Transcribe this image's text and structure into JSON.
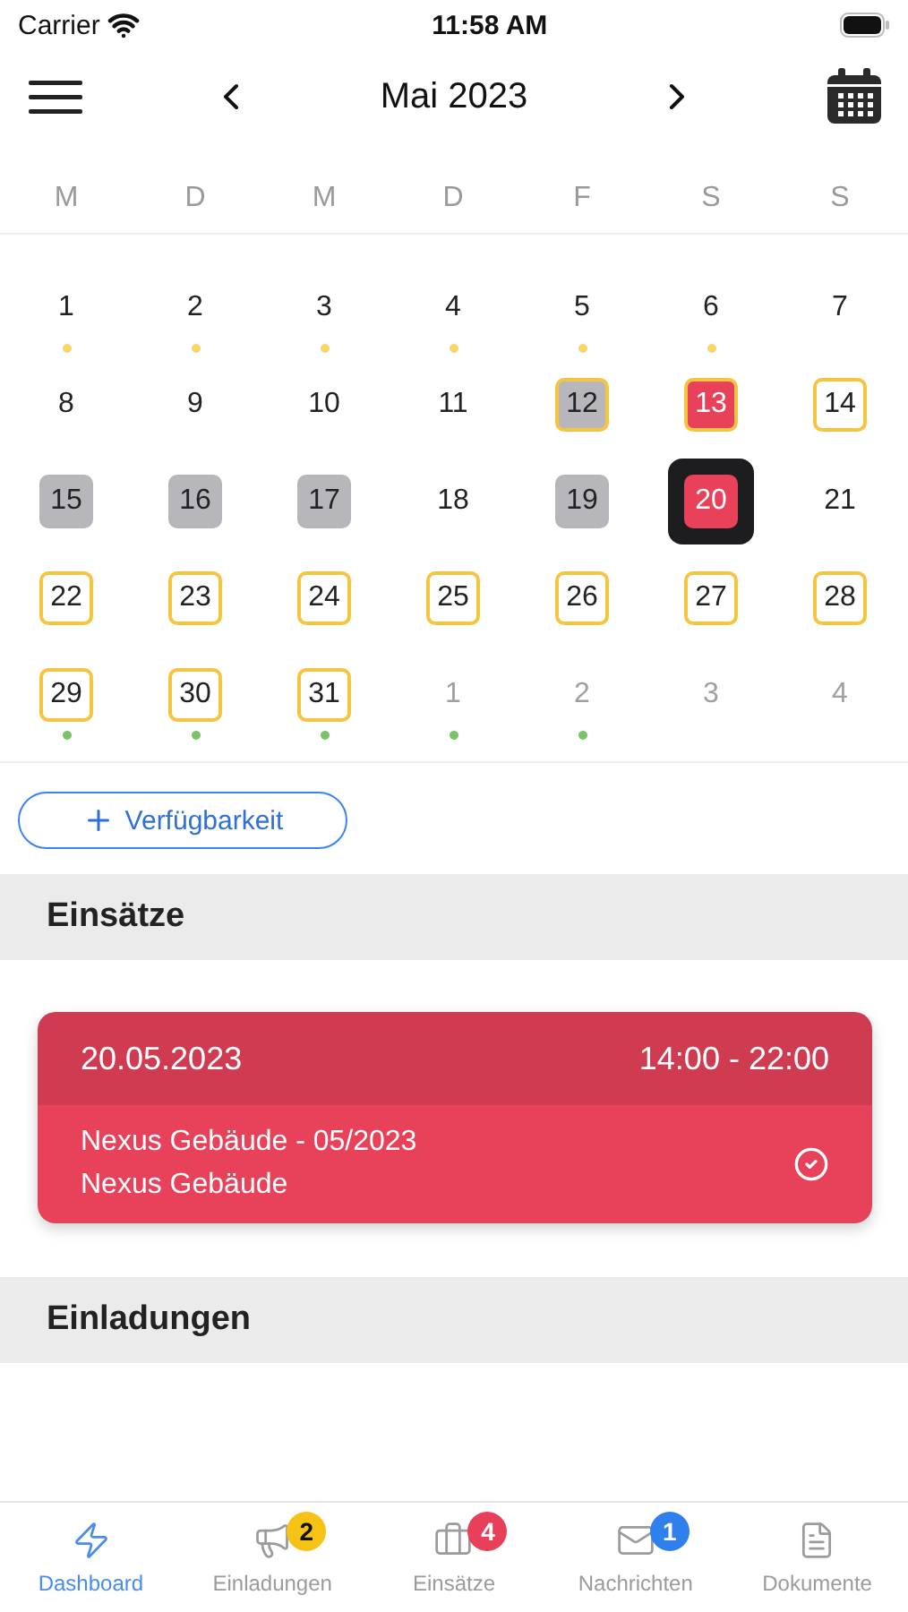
{
  "status_bar": {
    "carrier": "Carrier",
    "time": "11:58 AM"
  },
  "header": {
    "title": "Mai 2023"
  },
  "weekdays": [
    "M",
    "D",
    "M",
    "D",
    "F",
    "S",
    "S"
  ],
  "days": [
    {
      "day": "1",
      "kind": "plain",
      "muted": false,
      "selected": false,
      "color": "#f5d66b"
    },
    {
      "day": "2",
      "kind": "plain",
      "muted": false,
      "selected": false,
      "color": "#f5d66b"
    },
    {
      "day": "3",
      "kind": "plain",
      "muted": false,
      "selected": false,
      "color": "#f5d66b"
    },
    {
      "day": "4",
      "kind": "plain",
      "muted": false,
      "selected": false,
      "color": "#f5d66b"
    },
    {
      "day": "5",
      "kind": "plain",
      "muted": false,
      "selected": false,
      "color": "#f5d66b"
    },
    {
      "day": "6",
      "kind": "plain",
      "muted": false,
      "selected": false,
      "color": "#f5d66b"
    },
    {
      "day": "7",
      "kind": "plain",
      "muted": false,
      "selected": false
    },
    {
      "day": "8",
      "kind": "plain",
      "muted": false,
      "selected": false
    },
    {
      "day": "9",
      "kind": "plain",
      "muted": false,
      "selected": false
    },
    {
      "day": "10",
      "kind": "plain",
      "muted": false,
      "selected": false
    },
    {
      "day": "11",
      "kind": "plain",
      "muted": false,
      "selected": false
    },
    {
      "day": "12",
      "kind": "grey-outlined",
      "muted": false,
      "selected": false
    },
    {
      "day": "13",
      "kind": "red-outlined",
      "muted": false,
      "selected": false
    },
    {
      "day": "14",
      "kind": "outlined",
      "muted": false,
      "selected": false
    },
    {
      "day": "15",
      "kind": "grey",
      "muted": false,
      "selected": false
    },
    {
      "day": "16",
      "kind": "grey",
      "muted": false,
      "selected": false
    },
    {
      "day": "17",
      "kind": "grey",
      "muted": false,
      "selected": false
    },
    {
      "day": "18",
      "kind": "plain",
      "muted": false,
      "selected": false
    },
    {
      "day": "19",
      "kind": "grey",
      "muted": false,
      "selected": false
    },
    {
      "day": "20",
      "kind": "red",
      "muted": false,
      "selected": true
    },
    {
      "day": "21",
      "kind": "plain",
      "muted": false,
      "selected": false
    },
    {
      "day": "22",
      "kind": "outlined",
      "muted": false,
      "selected": false
    },
    {
      "day": "23",
      "kind": "outlined",
      "muted": false,
      "selected": false
    },
    {
      "day": "24",
      "kind": "outlined",
      "muted": false,
      "selected": false
    },
    {
      "day": "25",
      "kind": "outlined",
      "muted": false,
      "selected": false
    },
    {
      "day": "26",
      "kind": "outlined",
      "muted": false,
      "selected": false
    },
    {
      "day": "27",
      "kind": "outlined",
      "muted": false,
      "selected": false
    },
    {
      "day": "28",
      "kind": "outlined",
      "muted": false,
      "selected": false
    },
    {
      "day": "29",
      "kind": "outlined",
      "muted": false,
      "selected": false,
      "color": "#7cc36b"
    },
    {
      "day": "30",
      "kind": "outlined",
      "muted": false,
      "selected": false,
      "color": "#7cc36b"
    },
    {
      "day": "31",
      "kind": "outlined",
      "muted": false,
      "selected": false,
      "color": "#7cc36b"
    },
    {
      "day": "1",
      "kind": "plain",
      "muted": true,
      "selected": false,
      "color": "#7cc36b"
    },
    {
      "day": "2",
      "kind": "plain",
      "muted": true,
      "selected": false,
      "color": "#7cc36b"
    },
    {
      "day": "3",
      "kind": "plain",
      "muted": true,
      "selected": false
    },
    {
      "day": "4",
      "kind": "plain",
      "muted": true,
      "selected": false
    }
  ],
  "availability_button": {
    "label": "Verfügbarkeit"
  },
  "sections": [
    {
      "title": "Einsätze",
      "cards": [
        {
          "date": "20.05.2023",
          "time": "14:00 - 22:00",
          "lines": [
            "Nexus Gebäude - 05/2023",
            "Nexus Gebäude"
          ],
          "confirmed": true
        }
      ]
    },
    {
      "title": "Einladungen"
    }
  ],
  "tab_bar": [
    {
      "label": "Dashboard",
      "selected": true
    },
    {
      "label": "Einladungen",
      "selected": false,
      "badge": "2",
      "color": "#f6c216"
    },
    {
      "label": "Einsätze",
      "selected": false,
      "badge": "4",
      "color": "#e8405a"
    },
    {
      "label": "Nachrichten",
      "selected": false,
      "badge": "1",
      "color": "#2f80ed"
    },
    {
      "label": "Dokumente",
      "selected": false
    }
  ]
}
